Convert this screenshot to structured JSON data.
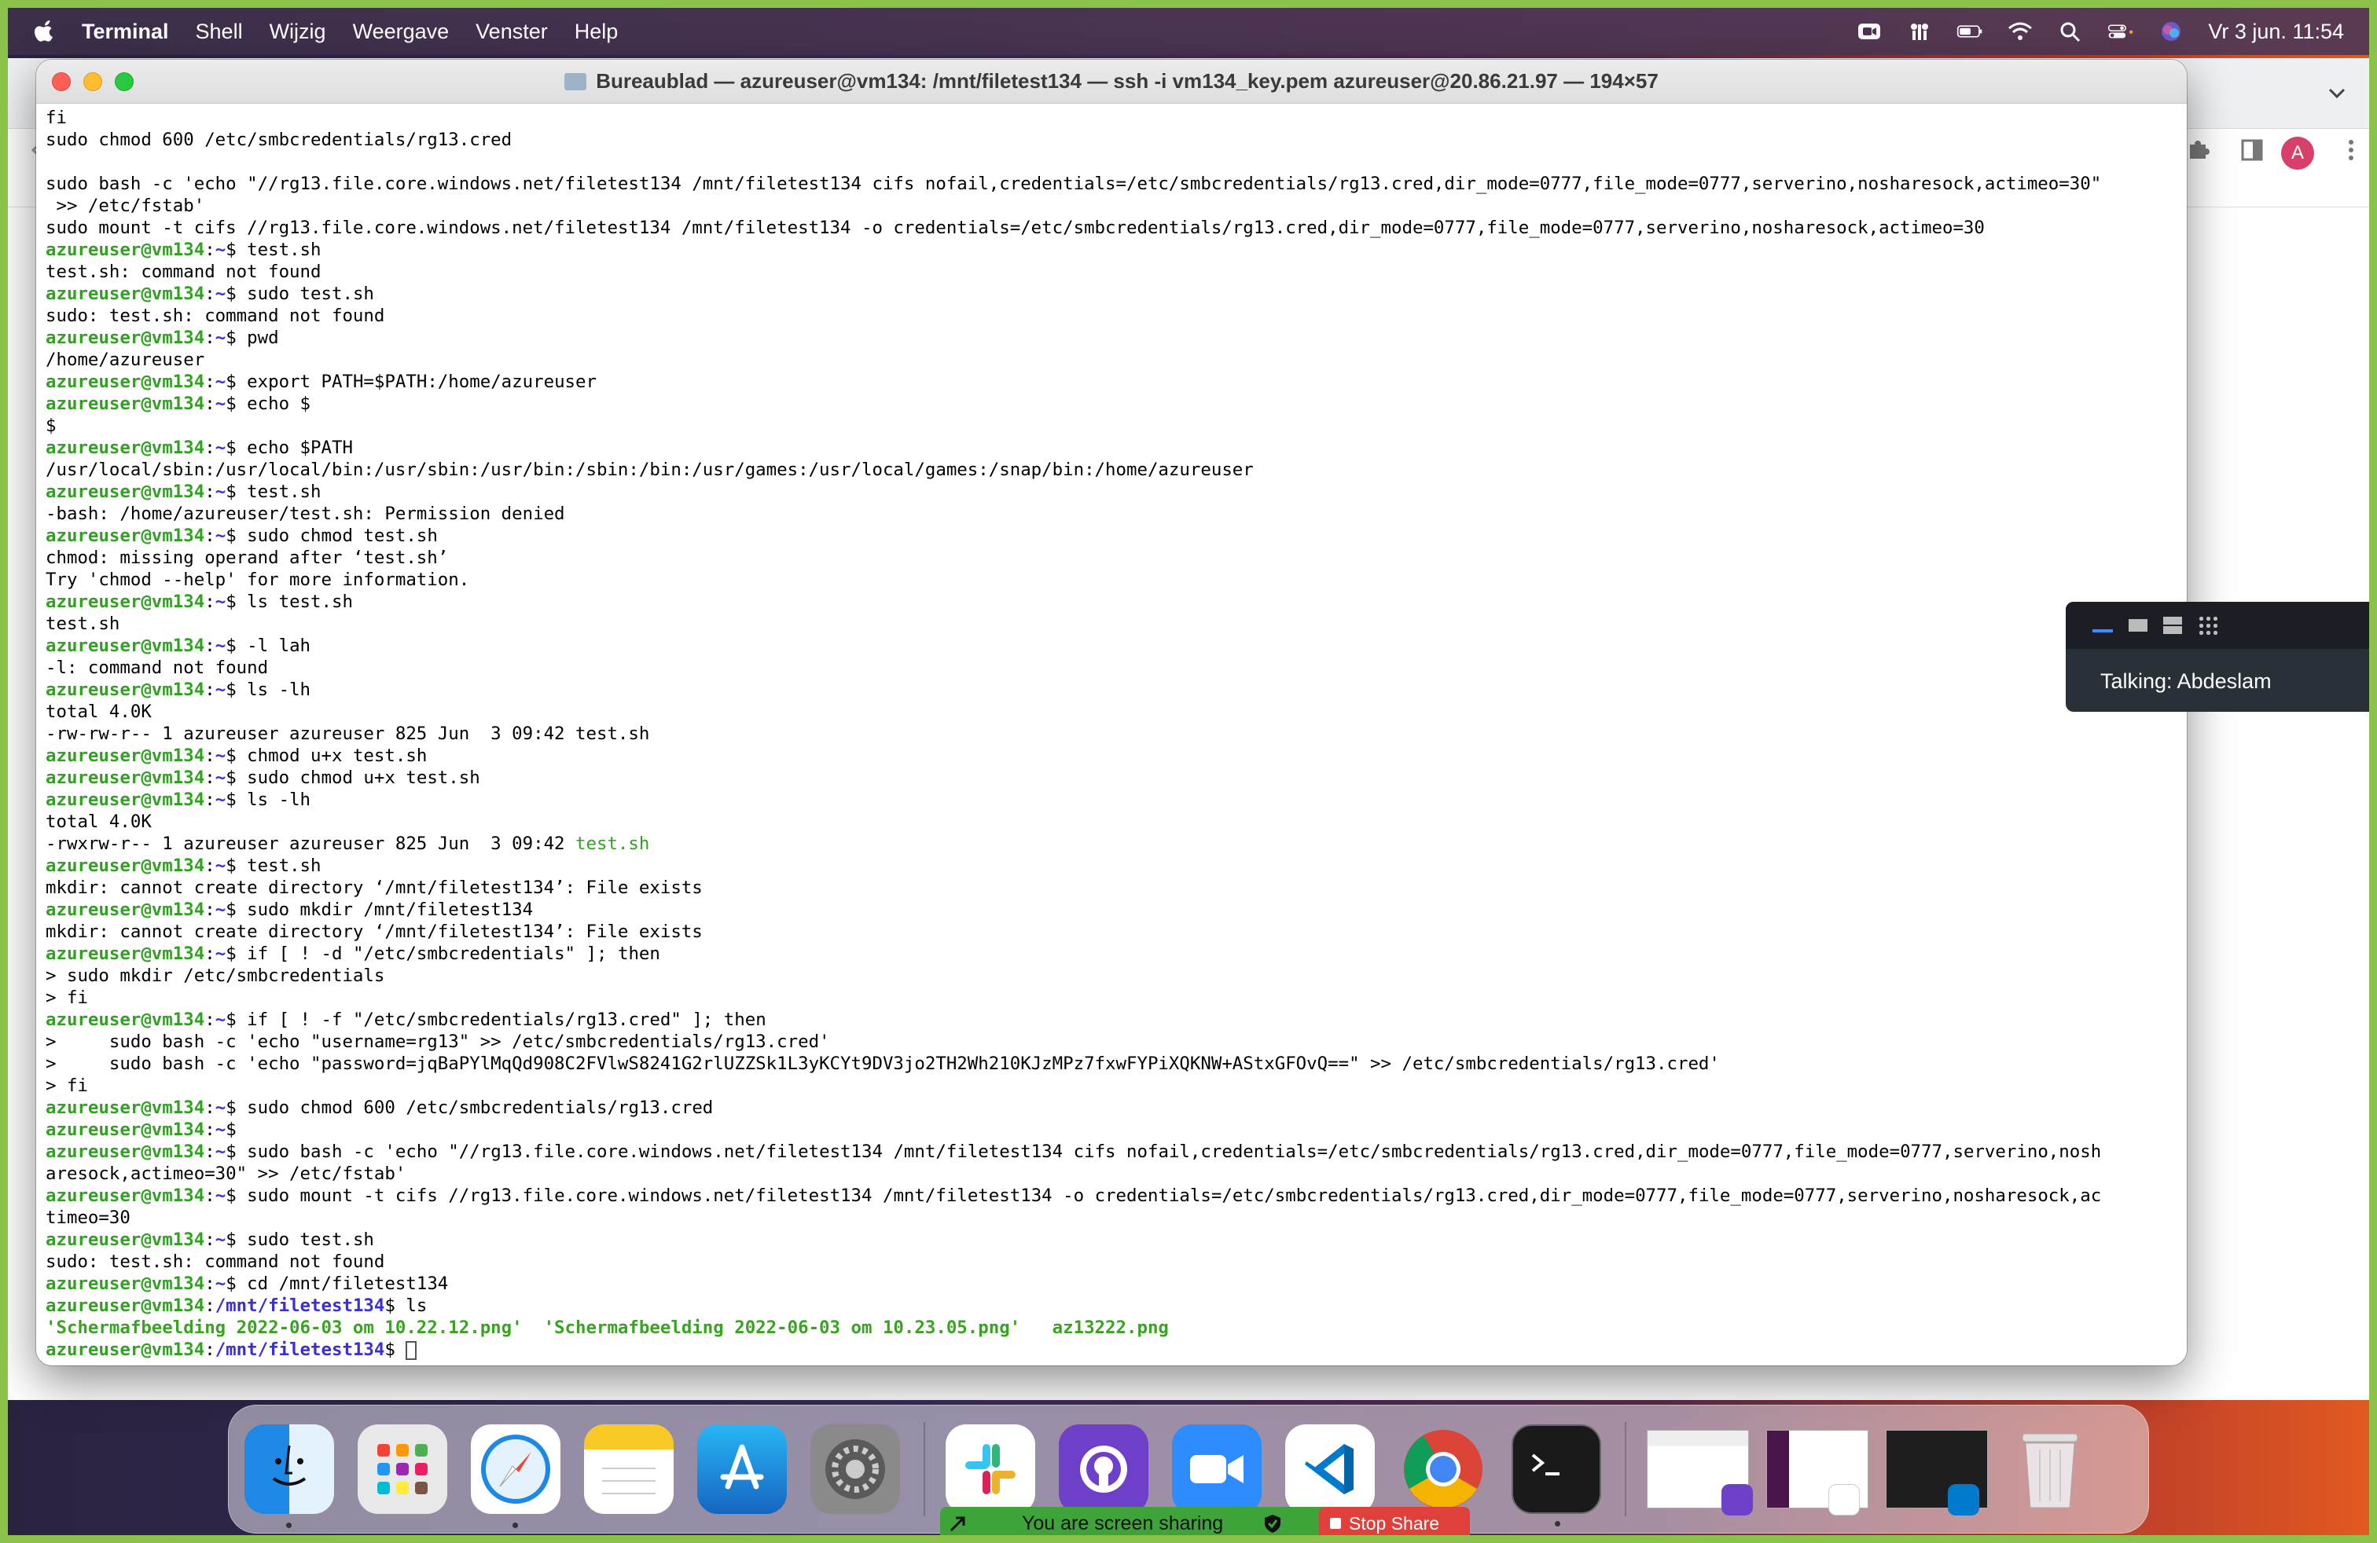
{
  "menubar": {
    "app_name": "Terminal",
    "items": [
      "Shell",
      "Wijzig",
      "Weergave",
      "Venster",
      "Help"
    ],
    "clock": "Vr 3 jun.  11:54"
  },
  "browser": {
    "avatar_letter": "A"
  },
  "terminal": {
    "title": "Bureaublad — azureuser@vm134: /mnt/filetest134 — ssh -i vm134_key.pem azureuser@20.86.21.97 — 194×57",
    "prompt_user": "azureuser@vm134",
    "lines": [
      {
        "t": "out",
        "text": "fi"
      },
      {
        "t": "out",
        "text": "sudo chmod 600 /etc/smbcredentials/rg13.cred"
      },
      {
        "t": "out",
        "text": ""
      },
      {
        "t": "out",
        "text": "sudo bash -c 'echo \"//rg13.file.core.windows.net/filetest134 /mnt/filetest134 cifs nofail,credentials=/etc/smbcredentials/rg13.cred,dir_mode=0777,file_mode=0777,serverino,nosharesock,actimeo=30\""
      },
      {
        "t": "out",
        "text": " >> /etc/fstab'"
      },
      {
        "t": "out",
        "text": "sudo mount -t cifs //rg13.file.core.windows.net/filetest134 /mnt/filetest134 -o credentials=/etc/smbcredentials/rg13.cred,dir_mode=0777,file_mode=0777,serverino,nosharesock,actimeo=30"
      },
      {
        "t": "cmd",
        "path": "~",
        "text": " test.sh"
      },
      {
        "t": "out",
        "text": "test.sh: command not found"
      },
      {
        "t": "cmd",
        "path": "~",
        "text": " sudo test.sh"
      },
      {
        "t": "out",
        "text": "sudo: test.sh: command not found"
      },
      {
        "t": "cmd",
        "path": "~",
        "text": " pwd"
      },
      {
        "t": "out",
        "text": "/home/azureuser"
      },
      {
        "t": "cmd",
        "path": "~",
        "text": " export PATH=$PATH:/home/azureuser"
      },
      {
        "t": "cmd",
        "path": "~",
        "text": " echo $"
      },
      {
        "t": "out",
        "text": "$"
      },
      {
        "t": "cmd",
        "path": "~",
        "text": " echo $PATH"
      },
      {
        "t": "out",
        "text": "/usr/local/sbin:/usr/local/bin:/usr/sbin:/usr/bin:/sbin:/bin:/usr/games:/usr/local/games:/snap/bin:/home/azureuser"
      },
      {
        "t": "cmd",
        "path": "~",
        "text": " test.sh"
      },
      {
        "t": "out",
        "text": "-bash: /home/azureuser/test.sh: Permission denied"
      },
      {
        "t": "cmd",
        "path": "~",
        "text": " sudo chmod test.sh"
      },
      {
        "t": "out",
        "text": "chmod: missing operand after ‘test.sh’"
      },
      {
        "t": "out",
        "text": "Try 'chmod --help' for more information."
      },
      {
        "t": "cmd",
        "path": "~",
        "text": " ls test.sh"
      },
      {
        "t": "out",
        "text": "test.sh"
      },
      {
        "t": "cmd",
        "path": "~",
        "text": " -l lah"
      },
      {
        "t": "out",
        "text": "-l: command not found"
      },
      {
        "t": "cmd",
        "path": "~",
        "text": " ls -lh"
      },
      {
        "t": "out",
        "text": "total 4.0K"
      },
      {
        "t": "out",
        "text": "-rw-rw-r-- 1 azureuser azureuser 825 Jun  3 09:42 test.sh"
      },
      {
        "t": "cmd",
        "path": "~",
        "text": " chmod u+x test.sh"
      },
      {
        "t": "cmd",
        "path": "~",
        "text": " sudo chmod u+x test.sh"
      },
      {
        "t": "cmd",
        "path": "~",
        "text": " ls -lh"
      },
      {
        "t": "out",
        "text": "total 4.0K"
      },
      {
        "t": "exe",
        "text": "-rwxrw-r-- 1 azureuser azureuser 825 Jun  3 09:42 ",
        "file": "test.sh"
      },
      {
        "t": "cmd",
        "path": "~",
        "text": " test.sh"
      },
      {
        "t": "out",
        "text": "mkdir: cannot create directory ‘/mnt/filetest134’: File exists"
      },
      {
        "t": "cmd",
        "path": "~",
        "text": " sudo mkdir /mnt/filetest134"
      },
      {
        "t": "out",
        "text": "mkdir: cannot create directory ‘/mnt/filetest134’: File exists"
      },
      {
        "t": "cmd",
        "path": "~",
        "text": " if [ ! -d \"/etc/smbcredentials\" ]; then"
      },
      {
        "t": "out",
        "text": "> sudo mkdir /etc/smbcredentials"
      },
      {
        "t": "out",
        "text": "> fi"
      },
      {
        "t": "cmd",
        "path": "~",
        "text": " if [ ! -f \"/etc/smbcredentials/rg13.cred\" ]; then"
      },
      {
        "t": "out",
        "text": ">     sudo bash -c 'echo \"username=rg13\" >> /etc/smbcredentials/rg13.cred'"
      },
      {
        "t": "out",
        "text": ">     sudo bash -c 'echo \"password=jqBaPYlMqQd908C2FVlwS8241G2rlUZZSk1L3yKCYt9DV3jo2TH2Wh210KJzMPz7fxwFYPiXQKNW+AStxGFOvQ==\" >> /etc/smbcredentials/rg13.cred'"
      },
      {
        "t": "out",
        "text": "> fi"
      },
      {
        "t": "cmd",
        "path": "~",
        "text": " sudo chmod 600 /etc/smbcredentials/rg13.cred"
      },
      {
        "t": "cmd",
        "path": "~",
        "text": ""
      },
      {
        "t": "cmd",
        "path": "~",
        "text": " sudo bash -c 'echo \"//rg13.file.core.windows.net/filetest134 /mnt/filetest134 cifs nofail,credentials=/etc/smbcredentials/rg13.cred,dir_mode=0777,file_mode=0777,serverino,nosh"
      },
      {
        "t": "out",
        "text": "aresock,actimeo=30\" >> /etc/fstab'"
      },
      {
        "t": "cmd",
        "path": "~",
        "text": " sudo mount -t cifs //rg13.file.core.windows.net/filetest134 /mnt/filetest134 -o credentials=/etc/smbcredentials/rg13.cred,dir_mode=0777,file_mode=0777,serverino,nosharesock,ac"
      },
      {
        "t": "out",
        "text": "timeo=30"
      },
      {
        "t": "cmd",
        "path": "~",
        "text": " sudo test.sh"
      },
      {
        "t": "out",
        "text": "sudo: test.sh: command not found"
      },
      {
        "t": "cmd",
        "path": "~",
        "text": " cd /mnt/filetest134"
      },
      {
        "t": "cmd",
        "path": "/mnt/filetest134",
        "text": " ls"
      },
      {
        "t": "files",
        "text": "'Schermafbeelding 2022-06-03 om 10.22.12.png'  'Schermafbeelding 2022-06-03 om 10.23.05.png'   az13222.png"
      },
      {
        "t": "cur",
        "path": "/mnt/filetest134",
        "text": " "
      }
    ]
  },
  "zoom_panel": {
    "talking": "Talking: Abdeslam"
  },
  "share_bar": {
    "sharing": "You are screen sharing",
    "stop": "Stop Share"
  },
  "dock_apps": [
    "finder-icon",
    "launchpad-icon",
    "safari-icon",
    "notes-icon",
    "app-store-icon",
    "system-preferences-icon",
    "slack-icon",
    "github-desktop-icon",
    "zoom-icon",
    "vscode-icon",
    "chrome-icon",
    "terminal-icon"
  ],
  "colors": {
    "prompt_green": "#2fa21f",
    "prompt_path_blue": "#3a2ed8",
    "share_green": "#3ea43a",
    "stop_red": "#e0403a"
  }
}
